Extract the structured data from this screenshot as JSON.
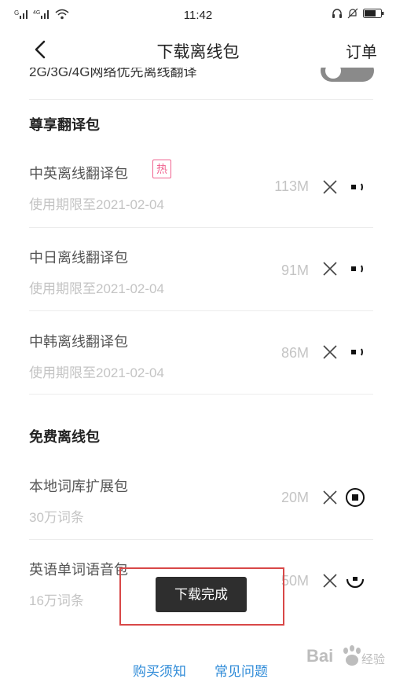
{
  "status_bar": {
    "signal_1_label": "G",
    "signal_2_label": "4G",
    "time": "11:42"
  },
  "nav": {
    "title": "下载离线包",
    "orders": "订单"
  },
  "setting_row": {
    "label": "2G/3G/4G网络优先离线翻译",
    "toggle_on": false
  },
  "sections": {
    "premium_title": "尊享翻译包",
    "free_title": "免费离线包"
  },
  "packs": [
    {
      "name": "中英离线翻译包",
      "badge": "热",
      "sub": "使用期限至2021-02-04",
      "size": "113M",
      "state": "downloading"
    },
    {
      "name": "中日离线翻译包",
      "sub": "使用期限至2021-02-04",
      "size": "91M",
      "state": "downloading"
    },
    {
      "name": "中韩离线翻译包",
      "sub": "使用期限至2021-02-04",
      "size": "86M",
      "state": "downloading"
    },
    {
      "name": "本地词库扩展包",
      "sub": "30万词条",
      "size": "20M",
      "state": "paused"
    },
    {
      "name": "英语单词语音包",
      "sub": "16万词条",
      "size": "50M",
      "state": "downloading"
    }
  ],
  "toast": "下载完成",
  "footer": {
    "purchase_notice": "购买须知",
    "faq": "常见问题"
  },
  "watermark": "Bai经验",
  "colors": {
    "accent_link": "#2f8bd8",
    "hot_badge": "#f0628f",
    "annotation_box": "#d84848",
    "muted_text": "#c4c4c4"
  }
}
